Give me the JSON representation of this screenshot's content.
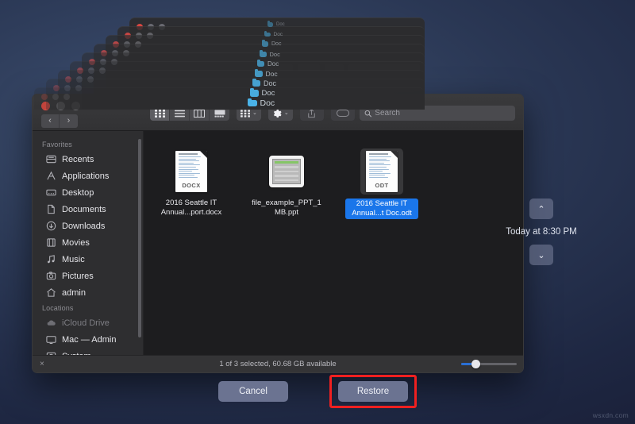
{
  "window": {
    "title_folder": "Doc",
    "traffic_lights": [
      "close",
      "minimize",
      "zoom"
    ],
    "nav": {
      "back": "‹",
      "forward": "›"
    }
  },
  "toolbar": {
    "view_modes": [
      {
        "name": "icon-view",
        "label": "Icon View",
        "active": true
      },
      {
        "name": "list-view",
        "label": "List View",
        "active": false
      },
      {
        "name": "column-view",
        "label": "Column View",
        "active": false
      },
      {
        "name": "gallery-view",
        "label": "Gallery View",
        "active": false
      }
    ],
    "group_button": "Group Items",
    "action_button": "Action",
    "share_button": "Share",
    "tags_button": "Tags",
    "chevron": "⌄"
  },
  "search": {
    "placeholder": "Search",
    "value": "",
    "icon": "search-icon"
  },
  "sidebar": {
    "sections": [
      {
        "heading": "Favorites",
        "items": [
          {
            "label": "Recents",
            "icon": "clock-recents-icon",
            "dim": false
          },
          {
            "label": "Applications",
            "icon": "applications-icon",
            "dim": false
          },
          {
            "label": "Desktop",
            "icon": "desktop-icon",
            "dim": false
          },
          {
            "label": "Documents",
            "icon": "documents-icon",
            "dim": false
          },
          {
            "label": "Downloads",
            "icon": "downloads-icon",
            "dim": false
          },
          {
            "label": "Movies",
            "icon": "movies-icon",
            "dim": false
          },
          {
            "label": "Music",
            "icon": "music-icon",
            "dim": false
          },
          {
            "label": "Pictures",
            "icon": "pictures-icon",
            "dim": false
          },
          {
            "label": "admin",
            "icon": "home-icon",
            "dim": false
          }
        ]
      },
      {
        "heading": "Locations",
        "items": [
          {
            "label": "iCloud Drive",
            "icon": "cloud-icon",
            "dim": true
          },
          {
            "label": "Mac — Admin",
            "icon": "display-icon",
            "dim": false
          },
          {
            "label": "System",
            "icon": "disk-icon",
            "dim": false
          }
        ]
      }
    ]
  },
  "files": [
    {
      "name": "2016 Seattle IT Annual...port.docx",
      "kind": "docx",
      "badge": "DOCX",
      "selected": false
    },
    {
      "name": "file_example_PPT_1MB.ppt",
      "kind": "ppt",
      "badge": "",
      "selected": false
    },
    {
      "name": "2016 Seattle IT Annual...t Doc.odt",
      "kind": "odt",
      "badge": "ODT",
      "selected": true
    }
  ],
  "statusbar": {
    "close_icon": "×",
    "text": "1 of 3 selected, 60.68 GB available",
    "zoom_slider_value": 22
  },
  "timeline": {
    "up_label": "⌃",
    "down_label": "⌄",
    "date_label": "Today at 8:30 PM"
  },
  "footer": {
    "cancel_label": "Cancel",
    "restore_label": "Restore",
    "highlight_color": "#ef2020"
  },
  "watermark": "wsxdn.com",
  "background_windows": [
    {
      "doc_label": "Doc"
    },
    {
      "doc_label": "Doc"
    },
    {
      "doc_label": "Doc"
    },
    {
      "doc_label": "Doc"
    },
    {
      "doc_label": "Doc"
    },
    {
      "doc_label": "Doc"
    },
    {
      "doc_label": "Doc"
    },
    {
      "doc_label": "Doc"
    },
    {
      "doc_label": "Doc"
    }
  ],
  "colors": {
    "accent_blue": "#1a76ea",
    "folder_blue": "#4ab3e8",
    "window_bg": "#2b2b2d",
    "content_bg": "#1d1d1f",
    "desktop_top": "#3e5070",
    "desktop_bottom": "#1a2039"
  }
}
